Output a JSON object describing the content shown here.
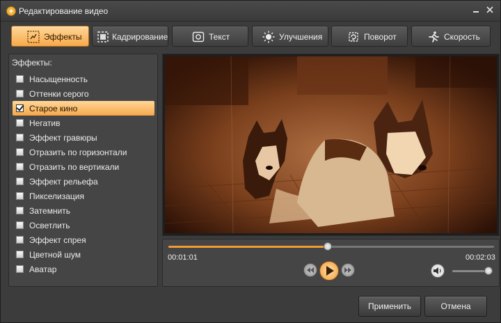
{
  "window": {
    "title": "Редактирование видео"
  },
  "tabs": [
    {
      "label": "Эффекты",
      "icon": "effects-icon",
      "active": true
    },
    {
      "label": "Кадрирование",
      "icon": "crop-icon",
      "active": false
    },
    {
      "label": "Текст",
      "icon": "text-icon",
      "active": false
    },
    {
      "label": "Улучшения",
      "icon": "brightness-icon",
      "active": false
    },
    {
      "label": "Поворот",
      "icon": "rotate-icon",
      "active": false
    },
    {
      "label": "Скорость",
      "icon": "running-man-icon",
      "active": false
    }
  ],
  "effects": {
    "heading": "Эффекты:",
    "items": [
      {
        "label": "Насыщенность",
        "checked": false
      },
      {
        "label": "Оттенки серого",
        "checked": false
      },
      {
        "label": "Старое кино",
        "checked": true
      },
      {
        "label": "Негатив",
        "checked": false
      },
      {
        "label": "Эффект гравюры",
        "checked": false
      },
      {
        "label": "Отразить по горизонтали",
        "checked": false
      },
      {
        "label": "Отразить по вертикали",
        "checked": false
      },
      {
        "label": "Эффект рельефа",
        "checked": false
      },
      {
        "label": "Пикселизация",
        "checked": false
      },
      {
        "label": "Затемнить",
        "checked": false
      },
      {
        "label": "Осветлить",
        "checked": false
      },
      {
        "label": "Эффект спрея",
        "checked": false
      },
      {
        "label": "Цветной шум",
        "checked": false
      },
      {
        "label": "Аватар",
        "checked": false
      }
    ]
  },
  "player": {
    "current_time": "00:01:01",
    "total_time": "00:02:03",
    "progress": 0.49,
    "volume": 1.0
  },
  "buttons": {
    "apply": "Применить",
    "cancel": "Отмена"
  },
  "colors": {
    "accent": "#f39a35",
    "active_tab": "#f8b45c",
    "background": "#3c3c3c"
  }
}
